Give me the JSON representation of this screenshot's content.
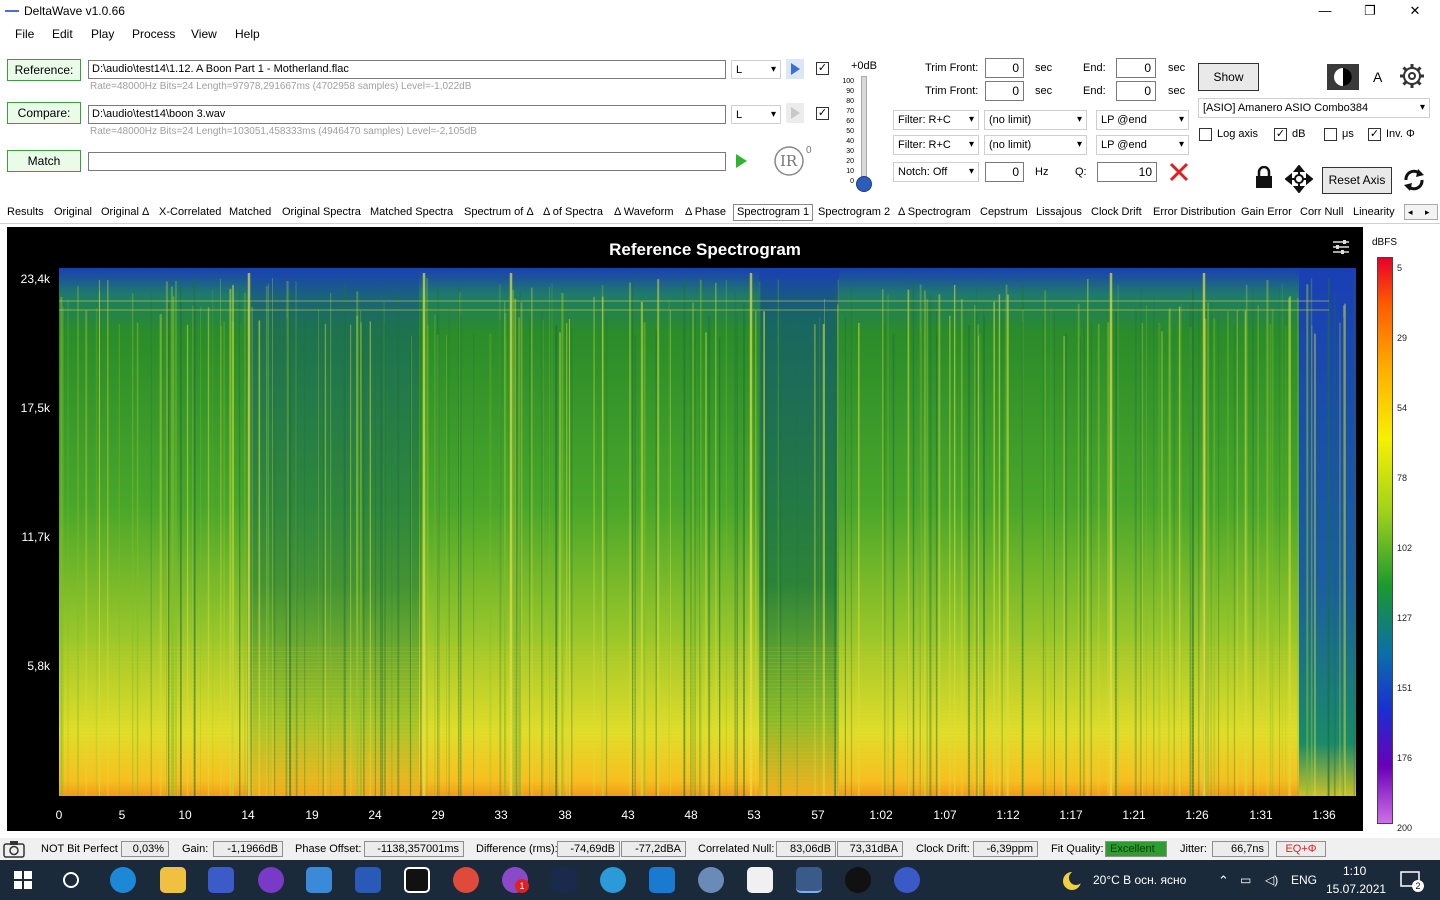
{
  "window": {
    "title": "DeltaWave v1.0.66",
    "min": "—",
    "max": "❐",
    "close": "✕"
  },
  "menu": [
    "File",
    "Edit",
    "Play",
    "Process",
    "View",
    "Help"
  ],
  "reference": {
    "button": "Reference:",
    "path": "D:\\audio\\test14\\1.12. A Boon Part 1 - Motherland.flac",
    "info": "Rate=48000Hz Bits=24 Length=97978,291667ms (4702958 samples) Level=-1,022dB",
    "channel": "L",
    "checked": "✓"
  },
  "compare": {
    "button": "Compare:",
    "path": "D:\\audio\\test14\\boon 3.wav",
    "info": "Rate=48000Hz Bits=24 Length=103051,458333ms (4946470 samples) Level=-2,105dB",
    "channel": "L",
    "checked": "✓"
  },
  "match": {
    "button": "Match",
    "path": ""
  },
  "ir_label": "IR",
  "ir_exp": "0",
  "level": {
    "top": "+0dB",
    "ticks": [
      "100",
      "90",
      "80",
      "70",
      "60",
      "50",
      "40",
      "30",
      "20",
      "10",
      "0"
    ],
    "value_pct": 0
  },
  "trim": {
    "front_label": "Trim Front:",
    "front1": "0",
    "front2": "0",
    "end_label": "End:",
    "end1": "0",
    "end2": "0",
    "unit": "sec"
  },
  "filters": {
    "filter1": "Filter: R+C",
    "filter2": "Filter: R+C",
    "limit1": "(no limit)",
    "limit2": "(no limit)",
    "lp1": "LP @end",
    "lp2": "LP @end",
    "notch": "Notch: Off",
    "notch_hz": "0",
    "hz_unit": "Hz",
    "q_label": "Q:",
    "q_value": "10"
  },
  "right": {
    "show": "Show",
    "a_label": "A",
    "device": "[ASIO] Amanero ASIO Combo384",
    "log_axis": "Log axis",
    "log_checked": "",
    "db": "dB",
    "db_checked": "✓",
    "us": "μs",
    "us_checked": "",
    "inv": "Inv. Φ",
    "inv_checked": "✓",
    "reset": "Reset Axis"
  },
  "tabs": [
    "Results",
    "Original",
    "Original Δ",
    "X-Correlated",
    "Matched",
    "Original Spectra",
    "Matched Spectra",
    "Spectrum of Δ",
    "Δ of Spectra",
    "Δ Waveform",
    "Δ Phase",
    "Spectrogram 1",
    "Spectrogram 2",
    "Δ Spectrogram",
    "Cepstrum",
    "Lissajous",
    "Clock Drift",
    "Error Distribution",
    "Gain Error",
    "Corr Null",
    "Linearity"
  ],
  "active_tab": "Spectrogram 1",
  "tab_scroll_left": "◂",
  "tab_scroll_right": "▸",
  "plot": {
    "title": "Reference Spectrogram",
    "yticks": [
      "23,4k",
      "17,5k",
      "11,7k",
      "5,8k"
    ],
    "xticks": [
      "0",
      "5",
      "10",
      "14",
      "19",
      "24",
      "29",
      "33",
      "38",
      "43",
      "48",
      "53",
      "57",
      "1:02",
      "1:07",
      "1:12",
      "1:17",
      "1:21",
      "1:26",
      "1:31",
      "1:36"
    ],
    "cbar_title": "dBFS",
    "cbar_ticks": [
      "5",
      "29",
      "54",
      "78",
      "102",
      "127",
      "151",
      "176",
      "200"
    ]
  },
  "status": {
    "bitperfect": "NOT Bit Perfect",
    "bitperfect_val": "0,03%",
    "gain": "Gain:",
    "gain_val": "-1,1966dB",
    "phase": "Phase Offset:",
    "phase_val": "-1138,357001ms",
    "diff": "Difference (rms):",
    "diff_val1": "-74,69dB",
    "diff_val2": "-77,2dBA",
    "cnull": "Correlated Null:",
    "cnull_val1": "83,06dB",
    "cnull_val2": "73,31dBA",
    "drift": "Clock Drift:",
    "drift_val": "-6,39ppm",
    "fit": "Fit Quality:",
    "fit_val": "Excellent",
    "jitter": "Jitter:",
    "jitter_val": "66,7ns",
    "eq": "EQ+Φ"
  },
  "taskbar": {
    "weather": "20°C  В осн. ясно",
    "lang": "ENG",
    "time": "1:10",
    "date": "15.07.2021",
    "notif": "2",
    "ap_badge": "1"
  },
  "colors": {
    "accent": "#4a6fd8",
    "fit_bg": "#2e9d2e",
    "eq": "#e02020",
    "taskbar": "#1b2a3a"
  }
}
